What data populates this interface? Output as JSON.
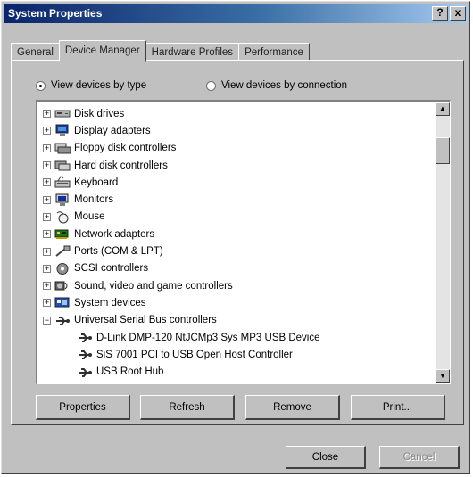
{
  "window": {
    "title": "System Properties",
    "help_label": "?",
    "close_label": "x"
  },
  "tabs": [
    {
      "label": "General"
    },
    {
      "label": "Device Manager",
      "active": true
    },
    {
      "label": "Hardware Profiles"
    },
    {
      "label": "Performance"
    }
  ],
  "view": {
    "by_type_label": "View devices by type",
    "by_connection_label": "View devices by connection",
    "selected": "by_type"
  },
  "devices": [
    {
      "label": "Disk drives",
      "expander": "+",
      "icon": "disk-drive-icon"
    },
    {
      "label": "Display adapters",
      "expander": "+",
      "icon": "display-adapter-icon"
    },
    {
      "label": "Floppy disk controllers",
      "expander": "+",
      "icon": "floppy-controller-icon"
    },
    {
      "label": "Hard disk controllers",
      "expander": "+",
      "icon": "hard-disk-controller-icon"
    },
    {
      "label": "Keyboard",
      "expander": "+",
      "icon": "keyboard-icon"
    },
    {
      "label": "Monitors",
      "expander": "+",
      "icon": "monitor-icon"
    },
    {
      "label": "Mouse",
      "expander": "+",
      "icon": "mouse-icon"
    },
    {
      "label": "Network adapters",
      "expander": "+",
      "icon": "network-adapter-icon"
    },
    {
      "label": "Ports (COM & LPT)",
      "expander": "+",
      "icon": "port-icon"
    },
    {
      "label": "SCSI controllers",
      "expander": "+",
      "icon": "scsi-controller-icon"
    },
    {
      "label": "Sound, video and game controllers",
      "expander": "+",
      "icon": "sound-icon"
    },
    {
      "label": "System devices",
      "expander": "+",
      "icon": "system-devices-icon"
    },
    {
      "label": "Universal Serial Bus controllers",
      "expander": "−",
      "icon": "usb-icon",
      "children": [
        {
          "label": "D-Link DMP-120 NtJCMp3 Sys MP3 USB Device",
          "icon": "usb-device-icon"
        },
        {
          "label": "SiS 7001 PCI to USB Open Host Controller",
          "icon": "usb-device-icon"
        },
        {
          "label": "USB Root Hub",
          "icon": "usb-device-icon"
        }
      ]
    }
  ],
  "scrollbar": {
    "up_glyph": "▲",
    "down_glyph": "▼"
  },
  "buttons": {
    "properties": "Properties",
    "refresh": "Refresh",
    "remove": "Remove",
    "print": "Print...",
    "close": "Close",
    "cancel": "Cancel"
  }
}
